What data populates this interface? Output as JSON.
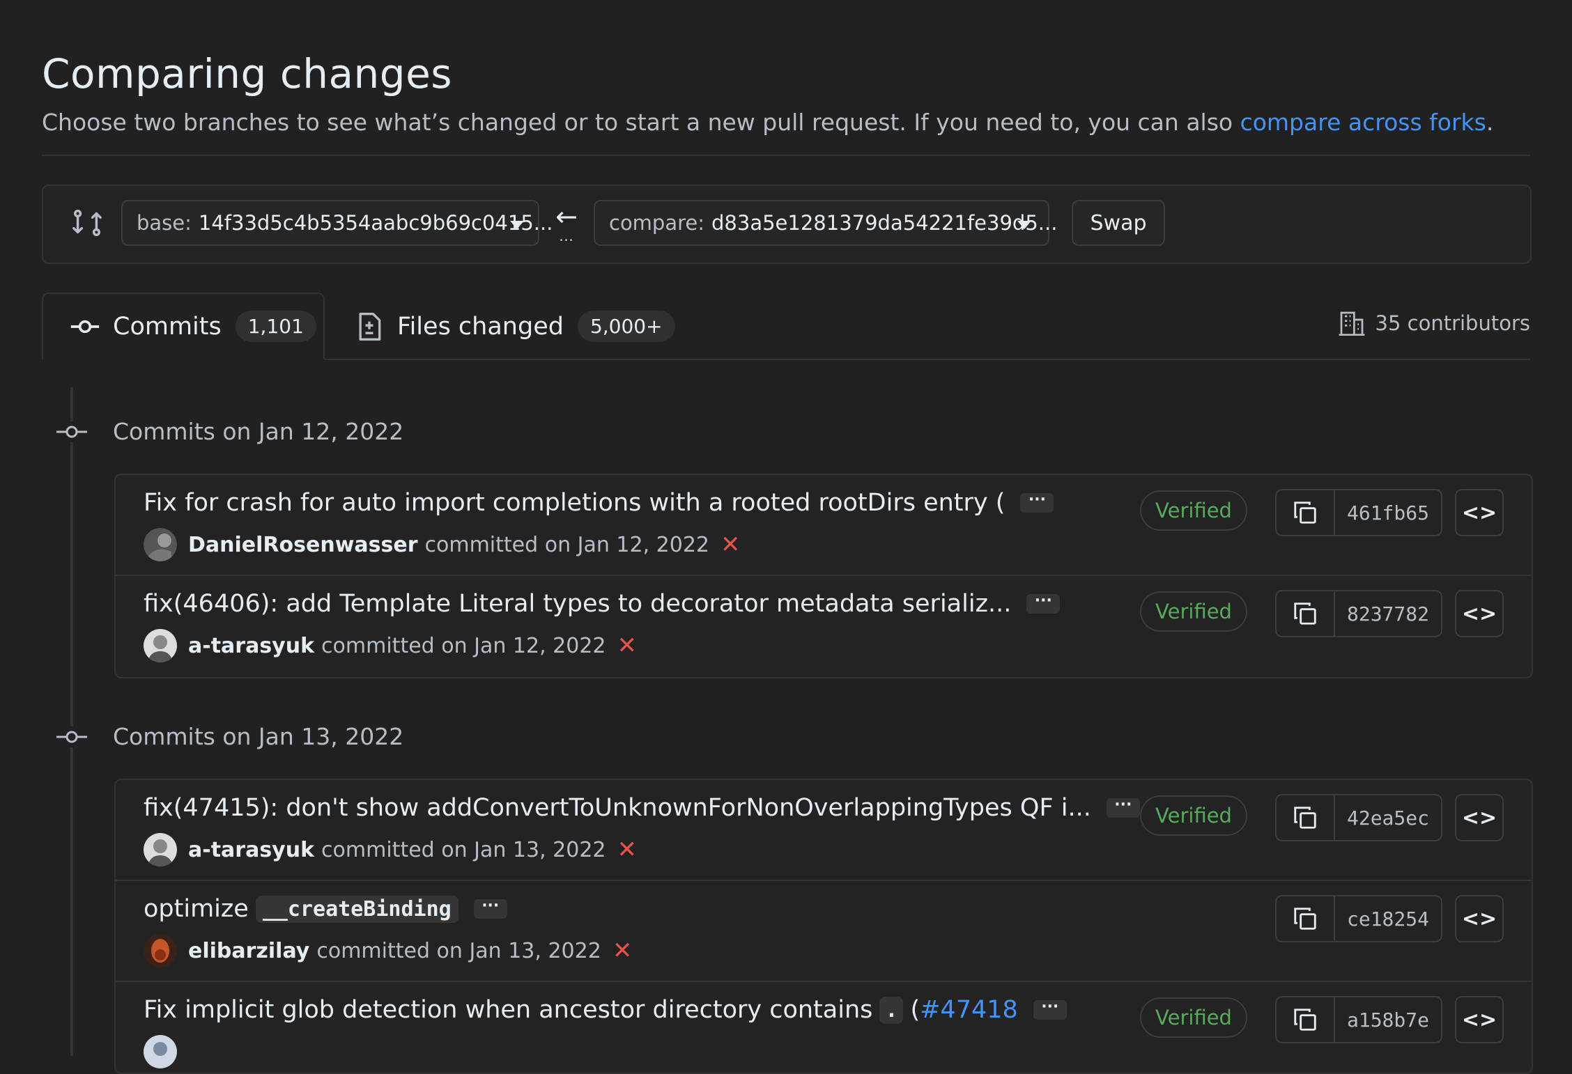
{
  "header": {
    "title": "Comparing changes",
    "subtitle": "Choose two branches to see what’s changed or to start a new pull request. If you need to, you can also ",
    "subtitle_link": "compare across forks",
    "subtitle_end": "."
  },
  "range": {
    "base_prefix": "base:",
    "base_value": "14f33d5c4b5354aabc9b69c0415...",
    "compare_prefix": "compare:",
    "compare_value": "d83a5e1281379da54221fe39d5...",
    "arrow": "←",
    "dots": "...",
    "swap_label": "Swap"
  },
  "tabs": {
    "commits_label": "Commits",
    "commits_count": "1,101",
    "files_label": "Files changed",
    "files_count": "5,000+",
    "contributors": "35 contributors"
  },
  "days": [
    {
      "label": "Commits on Jan 12, 2022",
      "commits": [
        {
          "message": "Fix for crash for auto import completions with a rooted rootDirs entry (",
          "author": "DanielRosenwasser",
          "date": "committed on Jan 12, 2022",
          "verified": "Verified",
          "sha": "461fb65",
          "ellipsis": "···"
        },
        {
          "message": "fix(46406): add Template Literal types to decorator metadata serializ...",
          "author": "a-tarasyuk",
          "date": "committed on Jan 12, 2022",
          "verified": "Verified",
          "sha": "8237782",
          "ellipsis": "···"
        }
      ]
    },
    {
      "label": "Commits on Jan 13, 2022",
      "commits": [
        {
          "message": "fix(47415): don't show addConvertToUnknownForNonOverlappingTypes QF i...",
          "author": "a-tarasyuk",
          "date": "committed on Jan 13, 2022",
          "verified": "Verified",
          "sha": "42ea5ec",
          "ellipsis": "···"
        },
        {
          "message": "optimize",
          "code": "__createBinding",
          "author": "elibarzilay",
          "date": "committed on Jan 13, 2022",
          "sha": "ce18254",
          "ellipsis": "···"
        },
        {
          "message": "Fix implicit glob detection when ancestor directory contains",
          "code": ".",
          "link_prefix": "(",
          "link": "#47418",
          "verified": "Verified",
          "sha": "a158b7e",
          "ellipsis": "···"
        }
      ]
    }
  ],
  "icons": {
    "fail": "✕",
    "browse": "<>"
  },
  "colors": {
    "background": "#212121",
    "link": "#4493f8",
    "verified": "#57ab5a",
    "fail": "#e5534b"
  }
}
